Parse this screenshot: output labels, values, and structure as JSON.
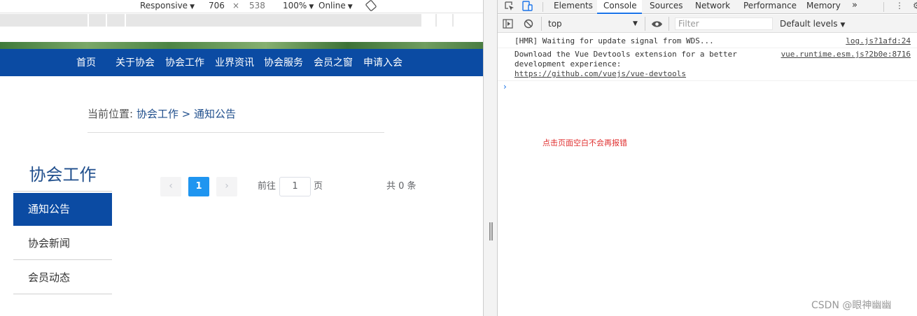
{
  "device_toolbar": {
    "device": "Responsive",
    "width": "706",
    "times": "×",
    "height": "538",
    "zoom": "100%",
    "throttle": "Online"
  },
  "site": {
    "nav": [
      "首页",
      "关于协会",
      "协会工作",
      "业界资讯",
      "协会服务",
      "会员之窗",
      "申请入会"
    ],
    "breadcrumb": {
      "prefix": "当前位置:",
      "section": "协会工作",
      "sep": ">",
      "current": "通知公告"
    },
    "sidebar": {
      "title": "协会工作",
      "items": [
        {
          "label": "通知公告",
          "active": true
        },
        {
          "label": "协会新闻",
          "active": false
        },
        {
          "label": "会员动态",
          "active": false
        }
      ]
    },
    "pagination": {
      "prev": "‹",
      "current": "1",
      "next": "›",
      "goto_prefix": "前往",
      "goto_value": "1",
      "goto_suffix": "页",
      "total": "共 0 条"
    }
  },
  "devtools": {
    "tabs": [
      "Elements",
      "Console",
      "Sources",
      "Network",
      "Performance",
      "Memory"
    ],
    "active_tab": "Console",
    "more": "»",
    "context": "top",
    "filter_placeholder": "Filter",
    "levels": "Default levels",
    "messages": [
      {
        "text": "[HMR] Waiting for update signal from WDS...",
        "source": "log.js?1afd:24"
      },
      {
        "text_line1": "Download the Vue Devtools extension for a better",
        "text_line2": "development experience:",
        "link": "https://github.com/vuejs/vue-devtools",
        "source": "vue.runtime.esm.js?2b0e:8716"
      }
    ],
    "prompt": "›"
  },
  "annotation": "点击页面空白不会再报错",
  "watermark": "CSDN @眼神幽幽",
  "colors": {
    "nav_bg": "#0b4ba3",
    "active_page": "#1f95f0",
    "link": "#1f4e8c",
    "annotation": "#e03030"
  }
}
